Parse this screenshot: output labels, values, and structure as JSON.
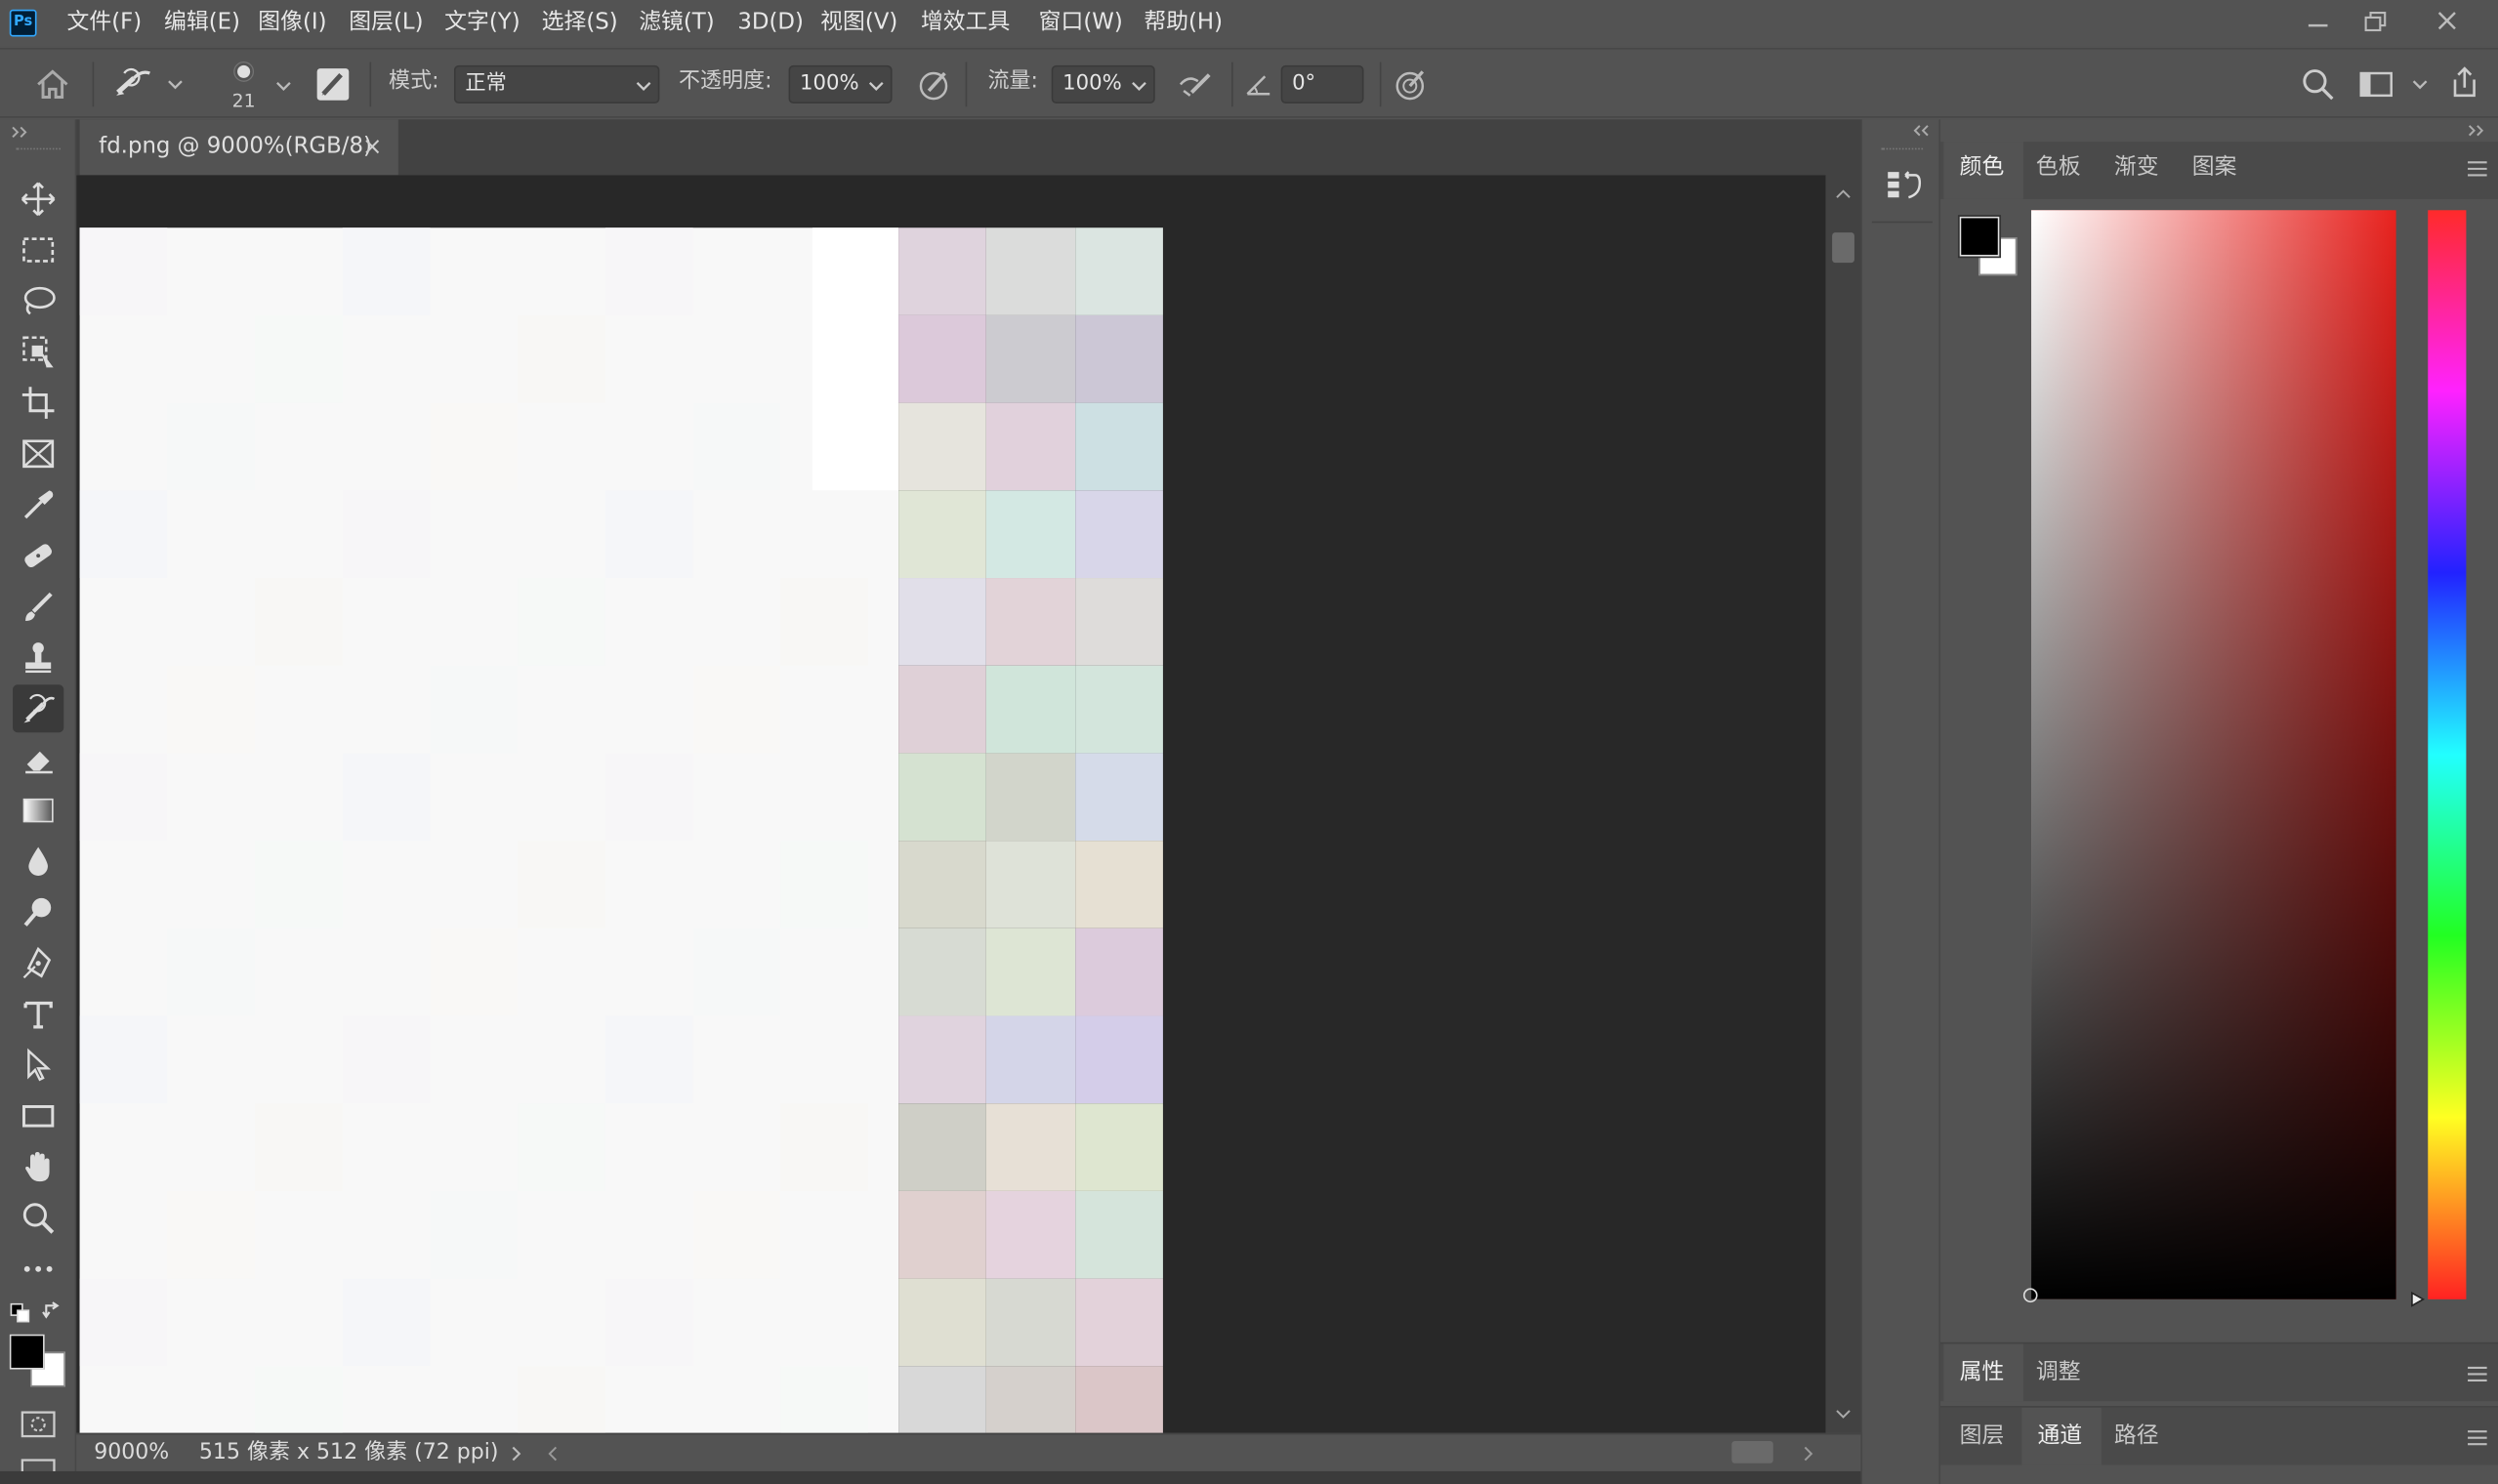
{
  "menubar": {
    "logo": "Ps",
    "items": [
      "文件(F)",
      "编辑(E)",
      "图像(I)",
      "图层(L)",
      "文字(Y)",
      "选择(S)",
      "滤镜(T)",
      "3D(D)",
      "视图(V)",
      "增效工具",
      "窗口(W)",
      "帮助(H)"
    ]
  },
  "options": {
    "brush_size": "21",
    "mode_label": "模式:",
    "mode_value": "正常",
    "opacity_label": "不透明度:",
    "opacity_value": "100%",
    "flow_label": "流量:",
    "flow_value": "100%",
    "angle_value": "0°"
  },
  "document": {
    "tab_title": "fd.png @ 9000%(RGB/8)",
    "close_glyph": "×"
  },
  "status": {
    "zoom": "9000%",
    "info": "515 像素 x 512 像素 (72 ppi)"
  },
  "color_panel": {
    "tabs": [
      "颜色",
      "色板",
      "渐变",
      "图案"
    ],
    "active_tab": "颜色",
    "hue_color": "#e8221e",
    "foreground": "#000000",
    "background": "#ffffff"
  },
  "properties_panel": {
    "tabs": [
      "属性",
      "调整"
    ],
    "active_tab": "属性"
  },
  "layers_panel": {
    "tabs": [
      "图层",
      "通道",
      "路径"
    ],
    "active_tab": "通道"
  },
  "tools": [
    "move-tool",
    "marquee-tool",
    "lasso-tool",
    "object-select-tool",
    "crop-tool",
    "frame-tool",
    "eyedropper-tool",
    "healing-brush-tool",
    "brush-tool",
    "clone-stamp-tool",
    "history-brush-tool",
    "eraser-tool",
    "gradient-tool",
    "blur-tool",
    "dodge-tool",
    "pen-tool",
    "type-tool",
    "path-select-tool",
    "rectangle-tool",
    "hand-tool",
    "zoom-tool",
    "more-tools"
  ],
  "active_tool": "history-brush-tool",
  "canvas_pixels": {
    "columns": [
      "#dfd3dd",
      "#dbdcdb",
      "#dbe5e1",
      "#dcc9da",
      "#cccbd0",
      "#ccc7d6",
      "#e6e4dd",
      "#e1d1dc",
      "#cde0e3",
      "#e0e6d6",
      "#d3e8e3",
      "#d8d6e9",
      "#e1dfe9",
      "#e2d3d8",
      "#dedcda",
      "#dfd0d7",
      "#d0e5da",
      "#d3e5dc",
      "#d5e2d1",
      "#d2d5cb",
      "#d5dbe9",
      "#d8d9cd",
      "#dee2d8",
      "#e6e0d3",
      "#d7dbd3",
      "#dde5d4",
      "#dccbdc",
      "#e0d3de",
      "#d4d5e8",
      "#d4cde9",
      "#cfcfc7",
      "#e7e0d6",
      "#dee6d0",
      "#e0d0cf",
      "#e5d3de",
      "#d5e4db",
      "#dfdfd2",
      "#d7d9d2",
      "#e3d2da",
      "#d8d8d8",
      "#d5d0cc",
      "#dbc6c8"
    ]
  }
}
